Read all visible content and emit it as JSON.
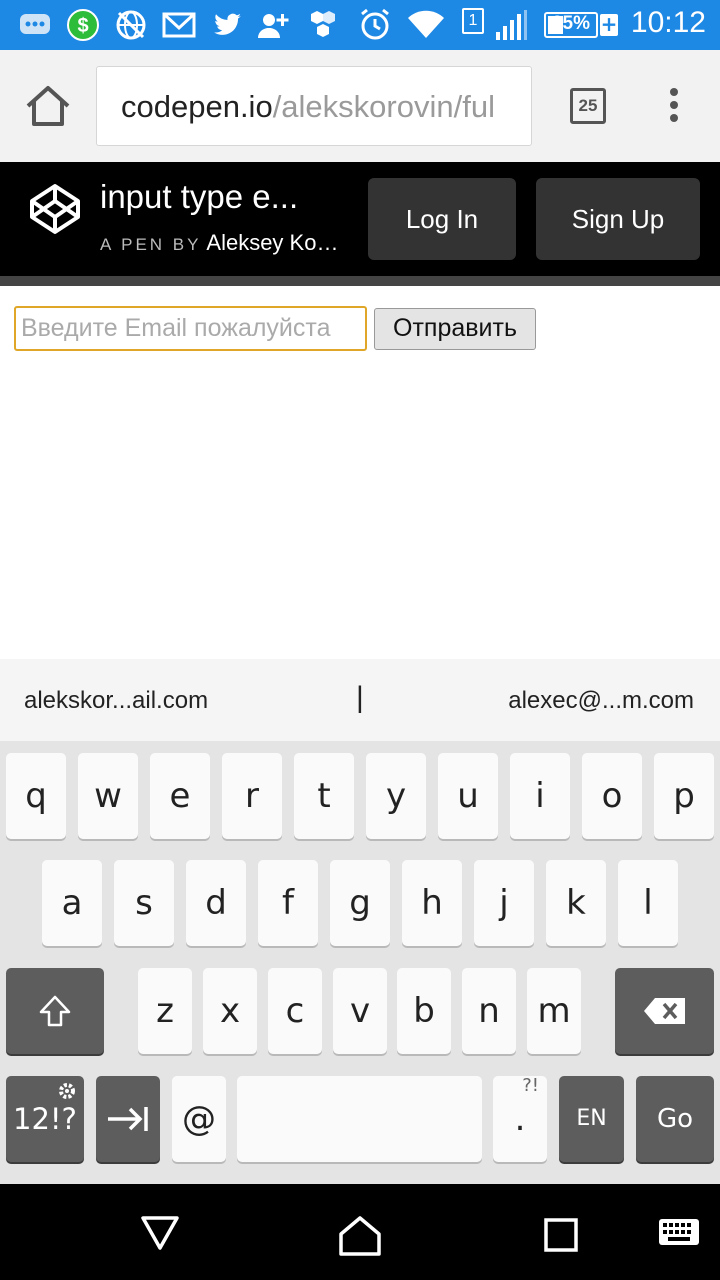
{
  "status_bar": {
    "time": "10:12",
    "battery_level": "35%",
    "sim_number": "1",
    "icons": [
      "messages-icon",
      "money-icon",
      "vpn-globe-icon",
      "gmail-icon",
      "twitter-icon",
      "add-contact-icon",
      "honeycomb-icon",
      "alarm-icon",
      "wifi-icon",
      "sim-icon",
      "signal-icon",
      "battery-icon"
    ]
  },
  "browser": {
    "url_host": "codepen.io",
    "url_path": "/alekskorovin/ful",
    "tab_count": "25"
  },
  "codepen": {
    "pen_title": "input type e...",
    "pen_by_label": "A PEN BY",
    "author": "Aleksey Kor...",
    "login_label": "Log In",
    "signup_label": "Sign Up"
  },
  "form": {
    "email_placeholder": "Введите Email пожалуйста",
    "submit_label": "Отправить"
  },
  "suggestions": {
    "left": "aleksko​r...ail.com",
    "middle": "|",
    "right": "alexec@...m.com"
  },
  "keyboard": {
    "row1": [
      "q",
      "w",
      "e",
      "r",
      "t",
      "y",
      "u",
      "i",
      "o",
      "p"
    ],
    "row2": [
      "a",
      "s",
      "d",
      "f",
      "g",
      "h",
      "j",
      "k",
      "l"
    ],
    "row3": [
      "z",
      "x",
      "c",
      "v",
      "b",
      "n",
      "m"
    ],
    "symbols_label": "12!?",
    "at_label": "@",
    "period_label": ".",
    "period_sup": "?!",
    "language_label": "EN",
    "go_label": "Go"
  }
}
